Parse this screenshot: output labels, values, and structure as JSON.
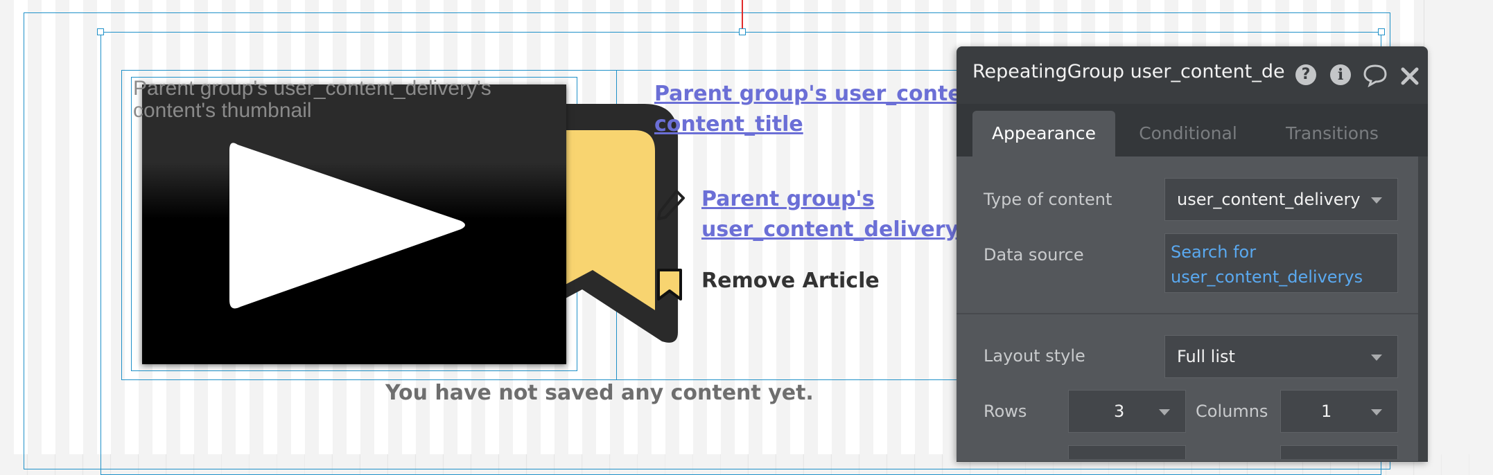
{
  "canvas": {
    "thumbnail_placeholder": "Parent group's user_content_delivery's content's thumbnail",
    "title_link": "Parent group's user_content_delivery's content_title",
    "title_link_line1": "Parent group's user_content_",
    "title_link_line2": "content_title",
    "author_link_line1": "Parent group's",
    "author_link_line2": "user_content_delivery's",
    "remove_label": "Remove Article",
    "empty_message": "You have not saved any content yet."
  },
  "panel": {
    "title": "RepeatingGroup user_content_de",
    "header_icons": [
      "help-icon",
      "info-icon",
      "comment-icon",
      "close-icon"
    ],
    "tabs": [
      {
        "label": "Appearance",
        "active": true
      },
      {
        "label": "Conditional",
        "active": false
      },
      {
        "label": "Transitions",
        "active": false
      }
    ],
    "type_of_content": {
      "label": "Type of content",
      "value": "user_content_delivery"
    },
    "data_source": {
      "label": "Data source",
      "line1": "Search for",
      "line2": "user_content_deliverys"
    },
    "layout_style": {
      "label": "Layout style",
      "value": "Full list"
    },
    "rows": {
      "label": "Rows",
      "value": "3"
    },
    "columns": {
      "label": "Columns",
      "value": "1"
    }
  },
  "colors": {
    "selection_blue": "#1e90c8",
    "link_purple": "#6b6fd6",
    "panel_dark": "#3a3d40",
    "bookmark_yellow": "#f8d470",
    "data_source_blue": "#5aa9f0"
  }
}
